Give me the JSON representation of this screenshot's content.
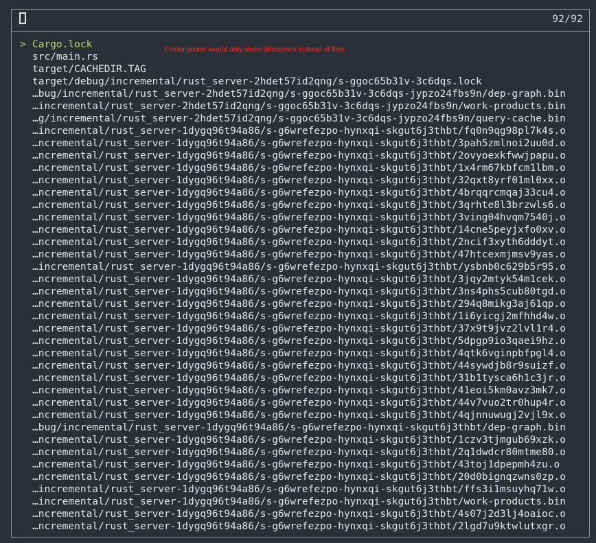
{
  "picker": {
    "counter": "92/92",
    "selected_marker": ">",
    "annotation": "Folder picker would only show directories instead of files",
    "items": [
      {
        "path": "Cargo.lock",
        "selected": true
      },
      {
        "path": "src/main.rs",
        "selected": false
      },
      {
        "path": "target/CACHEDIR.TAG",
        "selected": false
      },
      {
        "path": "target/debug/incremental/rust_server-2hdet57id2qng/s-ggoc65b31v-3c6dqs.lock",
        "selected": false
      },
      {
        "path": "…bug/incremental/rust_server-2hdet57id2qng/s-ggoc65b31v-3c6dqs-jypzo24fbs9n/dep-graph.bin",
        "selected": false
      },
      {
        "path": "…incremental/rust_server-2hdet57id2qng/s-ggoc65b31v-3c6dqs-jypzo24fbs9n/work-products.bin",
        "selected": false
      },
      {
        "path": "…g/incremental/rust_server-2hdet57id2qng/s-ggoc65b31v-3c6dqs-jypzo24fbs9n/query-cache.bin",
        "selected": false
      },
      {
        "path": "…incremental/rust_server-1dygq96t94a86/s-g6wrefezpo-hynxqi-skgut6j3thbt/fq0n9qg98pl7k4s.o",
        "selected": false
      },
      {
        "path": "…ncremental/rust_server-1dygq96t94a86/s-g6wrefezpo-hynxqi-skgut6j3thbt/3pah5zmlnoi2uu0d.o",
        "selected": false
      },
      {
        "path": "…ncremental/rust_server-1dygq96t94a86/s-g6wrefezpo-hynxqi-skgut6j3thbt/2ovyoexkfwwjpapu.o",
        "selected": false
      },
      {
        "path": "…ncremental/rust_server-1dygq96t94a86/s-g6wrefezpo-hynxqi-skgut6j3thbt/1x4rm67kbfcm1lbm.o",
        "selected": false
      },
      {
        "path": "…ncremental/rust_server-1dygq96t94a86/s-g6wrefezpo-hynxqi-skgut6j3thbt/32qxt8yrf01ml0xx.o",
        "selected": false
      },
      {
        "path": "…ncremental/rust_server-1dygq96t94a86/s-g6wrefezpo-hynxqi-skgut6j3thbt/4brqqrcmqaj33cu4.o",
        "selected": false
      },
      {
        "path": "…ncremental/rust_server-1dygq96t94a86/s-g6wrefezpo-hynxqi-skgut6j3thbt/3qrhte8l3brzwls6.o",
        "selected": false
      },
      {
        "path": "…ncremental/rust_server-1dygq96t94a86/s-g6wrefezpo-hynxqi-skgut6j3thbt/3ving04hvqm7540j.o",
        "selected": false
      },
      {
        "path": "…ncremental/rust_server-1dygq96t94a86/s-g6wrefezpo-hynxqi-skgut6j3thbt/14cne5peyjxfo0xv.o",
        "selected": false
      },
      {
        "path": "…ncremental/rust_server-1dygq96t94a86/s-g6wrefezpo-hynxqi-skgut6j3thbt/2ncif3xyth6dddyt.o",
        "selected": false
      },
      {
        "path": "…ncremental/rust_server-1dygq96t94a86/s-g6wrefezpo-hynxqi-skgut6j3thbt/47htcexmjmsv9yas.o",
        "selected": false
      },
      {
        "path": "…incremental/rust_server-1dygq96t94a86/s-g6wrefezpo-hynxqi-skgut6j3thbt/ysbnb0c629b5r95.o",
        "selected": false
      },
      {
        "path": "…ncremental/rust_server-1dygq96t94a86/s-g6wrefezpo-hynxqi-skgut6j3thbt/3jqy2mtyk54m1cek.o",
        "selected": false
      },
      {
        "path": "…ncremental/rust_server-1dygq96t94a86/s-g6wrefezpo-hynxqi-skgut6j3thbt/3ns4phs5cub80tgd.o",
        "selected": false
      },
      {
        "path": "…ncremental/rust_server-1dygq96t94a86/s-g6wrefezpo-hynxqi-skgut6j3thbt/294q8mikg3aj61qp.o",
        "selected": false
      },
      {
        "path": "…ncremental/rust_server-1dygq96t94a86/s-g6wrefezpo-hynxqi-skgut6j3thbt/1i6yicgj2mfhhd4w.o",
        "selected": false
      },
      {
        "path": "…ncremental/rust_server-1dygq96t94a86/s-g6wrefezpo-hynxqi-skgut6j3thbt/37x9t9jvz2lvl1r4.o",
        "selected": false
      },
      {
        "path": "…ncremental/rust_server-1dygq96t94a86/s-g6wrefezpo-hynxqi-skgut6j3thbt/5dpgp9io3qaei9hz.o",
        "selected": false
      },
      {
        "path": "…ncremental/rust_server-1dygq96t94a86/s-g6wrefezpo-hynxqi-skgut6j3thbt/4qtk6vginpbfpgl4.o",
        "selected": false
      },
      {
        "path": "…ncremental/rust_server-1dygq96t94a86/s-g6wrefezpo-hynxqi-skgut6j3thbt/44sywdjb8r9suizf.o",
        "selected": false
      },
      {
        "path": "…ncremental/rust_server-1dygq96t94a86/s-g6wrefezpo-hynxqi-skgut6j3thbt/31b1tysca6h1c3jr.o",
        "selected": false
      },
      {
        "path": "…ncremental/rust_server-1dygq96t94a86/s-g6wrefezpo-hynxqi-skgut6j3thbt/41eoi5km0avz3mk7.o",
        "selected": false
      },
      {
        "path": "…ncremental/rust_server-1dygq96t94a86/s-g6wrefezpo-hynxqi-skgut6j3thbt/44v7vuo2tr0hup4r.o",
        "selected": false
      },
      {
        "path": "…ncremental/rust_server-1dygq96t94a86/s-g6wrefezpo-hynxqi-skgut6j3thbt/4qjnnuwugj2vjl9x.o",
        "selected": false
      },
      {
        "path": "…bug/incremental/rust_server-1dygq96t94a86/s-g6wrefezpo-hynxqi-skgut6j3thbt/dep-graph.bin",
        "selected": false
      },
      {
        "path": "…ncremental/rust_server-1dygq96t94a86/s-g6wrefezpo-hynxqi-skgut6j3thbt/1czv3tjmgub69xzk.o",
        "selected": false
      },
      {
        "path": "…ncremental/rust_server-1dygq96t94a86/s-g6wrefezpo-hynxqi-skgut6j3thbt/2q1dwdcr80mtme80.o",
        "selected": false
      },
      {
        "path": "…ncremental/rust_server-1dygq96t94a86/s-g6wrefezpo-hynxqi-skgut6j3thbt/43toj1dpepmh4zu.o",
        "selected": false
      },
      {
        "path": "…ncremental/rust_server-1dygq96t94a86/s-g6wrefezpo-hynxqi-skgut6j3thbt/20d0bignqzwns0zp.o",
        "selected": false
      },
      {
        "path": "…incremental/rust_server-1dygq96t94a86/s-g6wrefezpo-hynxqi-skgut6j3thbt/ffs3i1msuyhq71w.o",
        "selected": false
      },
      {
        "path": "…incremental/rust_server-1dygq96t94a86/s-g6wrefezpo-hynxqi-skgut6j3thbt/work-products.bin",
        "selected": false
      },
      {
        "path": "…ncremental/rust_server-1dygq96t94a86/s-g6wrefezpo-hynxqi-skgut6j3thbt/4s07j2d3lj4oaioc.o",
        "selected": false
      },
      {
        "path": "…ncremental/rust_server-1dygq96t94a86/s-g6wrefezpo-hynxqi-skgut6j3thbt/2lgd7u9ktwlutxgr.o",
        "selected": false
      }
    ]
  }
}
